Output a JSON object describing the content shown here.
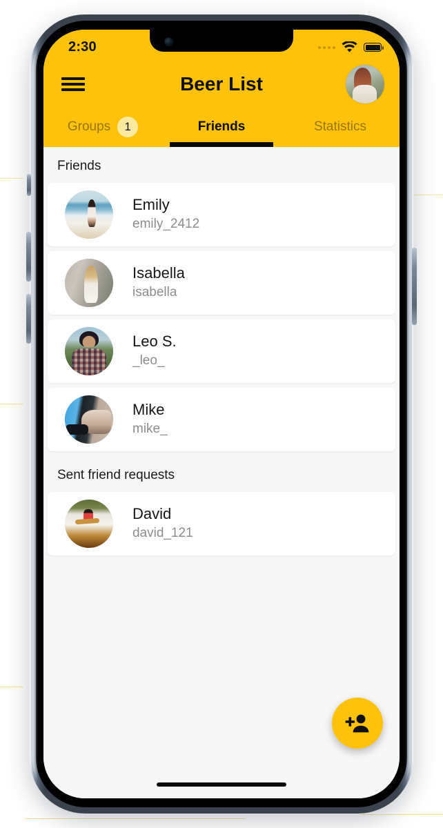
{
  "status_bar": {
    "time": "2:30",
    "cellular_icon": "cellular-dots-icon",
    "wifi_icon": "wifi-icon",
    "battery_icon": "battery-full-icon"
  },
  "app_bar": {
    "menu_icon": "hamburger-menu-icon",
    "title": "Beer List",
    "avatar_icon": "user-avatar-image"
  },
  "tabs": [
    {
      "label": "Groups",
      "badge": "1",
      "active": false
    },
    {
      "label": "Friends",
      "badge": "",
      "active": true
    },
    {
      "label": "Statistics",
      "badge": "",
      "active": false
    }
  ],
  "sections": [
    {
      "title": "Friends",
      "items": [
        {
          "name": "Emily",
          "handle": "emily_2412",
          "avatar": "emily-avatar-image"
        },
        {
          "name": "Isabella",
          "handle": "isabella",
          "avatar": "isabella-avatar-image"
        },
        {
          "name": "Leo S.",
          "handle": "_leo_",
          "avatar": "leo-avatar-image"
        },
        {
          "name": "Mike",
          "handle": "mike_",
          "avatar": "mike-avatar-image"
        }
      ]
    },
    {
      "title": "Sent friend requests",
      "items": [
        {
          "name": "David",
          "handle": "david_121",
          "avatar": "david-avatar-image"
        }
      ]
    }
  ],
  "fab": {
    "icon": "person-add-icon",
    "label": "Add friend"
  },
  "colors": {
    "brand_yellow": "#FFC20B",
    "badge_yellow": "#FFE9A1",
    "list_background": "#F7F7F7",
    "card_background": "#FFFFFF",
    "primary_text": "#161616",
    "secondary_text": "#8D8D8D",
    "inactive_tab_text": "rgba(0,0,0,0.40)"
  }
}
